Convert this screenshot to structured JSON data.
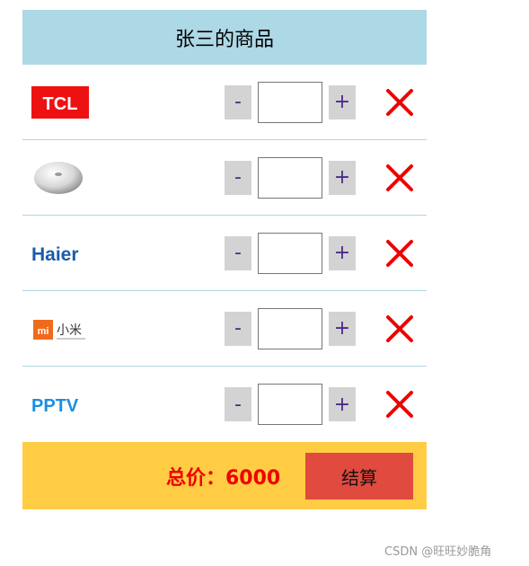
{
  "cart": {
    "title": "张三的商品",
    "items": [
      {
        "brand": "TCL",
        "logo_icon": "tcl-logo",
        "qty": "",
        "minus": "-",
        "plus": "+"
      },
      {
        "brand": "",
        "logo_icon": "device-logo",
        "qty": "",
        "minus": "-",
        "plus": "+"
      },
      {
        "brand": "Haier",
        "logo_icon": "haier-logo",
        "qty": "",
        "minus": "-",
        "plus": "+"
      },
      {
        "brand": "小米",
        "logo_icon": "xiaomi-logo",
        "qty": "",
        "minus": "-",
        "plus": "+"
      },
      {
        "brand": "PPTV",
        "logo_icon": "pptv-logo",
        "qty": "",
        "minus": "-",
        "plus": "+"
      }
    ],
    "total_label": "总价：6000",
    "checkout_label": "结算"
  },
  "colors": {
    "header_bg": "#add8e6",
    "footer_bg": "#ffcc44",
    "total_text": "#ee0000",
    "checkout_bg": "#e04a3f",
    "delete_icon": "#ee0000",
    "qty_btn_bg": "#d3d3d3"
  },
  "watermark": "CSDN @旺旺妙脆角"
}
